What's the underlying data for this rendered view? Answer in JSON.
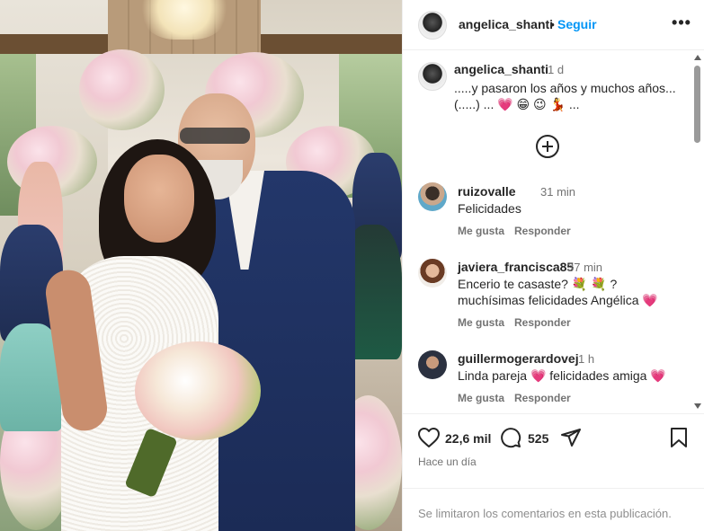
{
  "post": {
    "author": "angelica_shanti",
    "separator": "•",
    "follow_label": "Seguir",
    "more_label": "•••"
  },
  "caption": {
    "user": "angelica_shanti",
    "time": "1 d",
    "text": ".....y pasaron los años y muchos años...(.....) ... 💗 😁 😉 💃 ..."
  },
  "comments": [
    {
      "user": "ruizovalle",
      "time": "31 min",
      "text": "Felicidades",
      "like_label": "Me gusta",
      "reply_label": "Responder"
    },
    {
      "user": "javiera_francisca85",
      "time": "37 min",
      "text": "Encerio te casaste? 💐 💐 ? muchísimas felicidades Angélica 💗",
      "like_label": "Me gusta",
      "reply_label": "Responder"
    },
    {
      "user": "guillermogerardovej",
      "time": "1 h",
      "text": "Linda pareja 💗 felicidades amiga 💗",
      "like_label": "Me gusta",
      "reply_label": "Responder"
    }
  ],
  "stats": {
    "likes": "22,6 mil",
    "comments": "525",
    "posted": "Hace un día"
  },
  "footer": {
    "notice": "Se limitaron los comentarios en esta publicación."
  },
  "icons": {
    "like": "heart-icon",
    "comment": "comment-bubble-icon",
    "share": "paper-plane-icon",
    "save": "bookmark-icon",
    "more": "ellipsis-icon",
    "load_more": "plus-circle-icon"
  },
  "colors": {
    "accent": "#0095f6",
    "text": "#262626",
    "muted": "#737373",
    "heart": "#ed4956"
  }
}
